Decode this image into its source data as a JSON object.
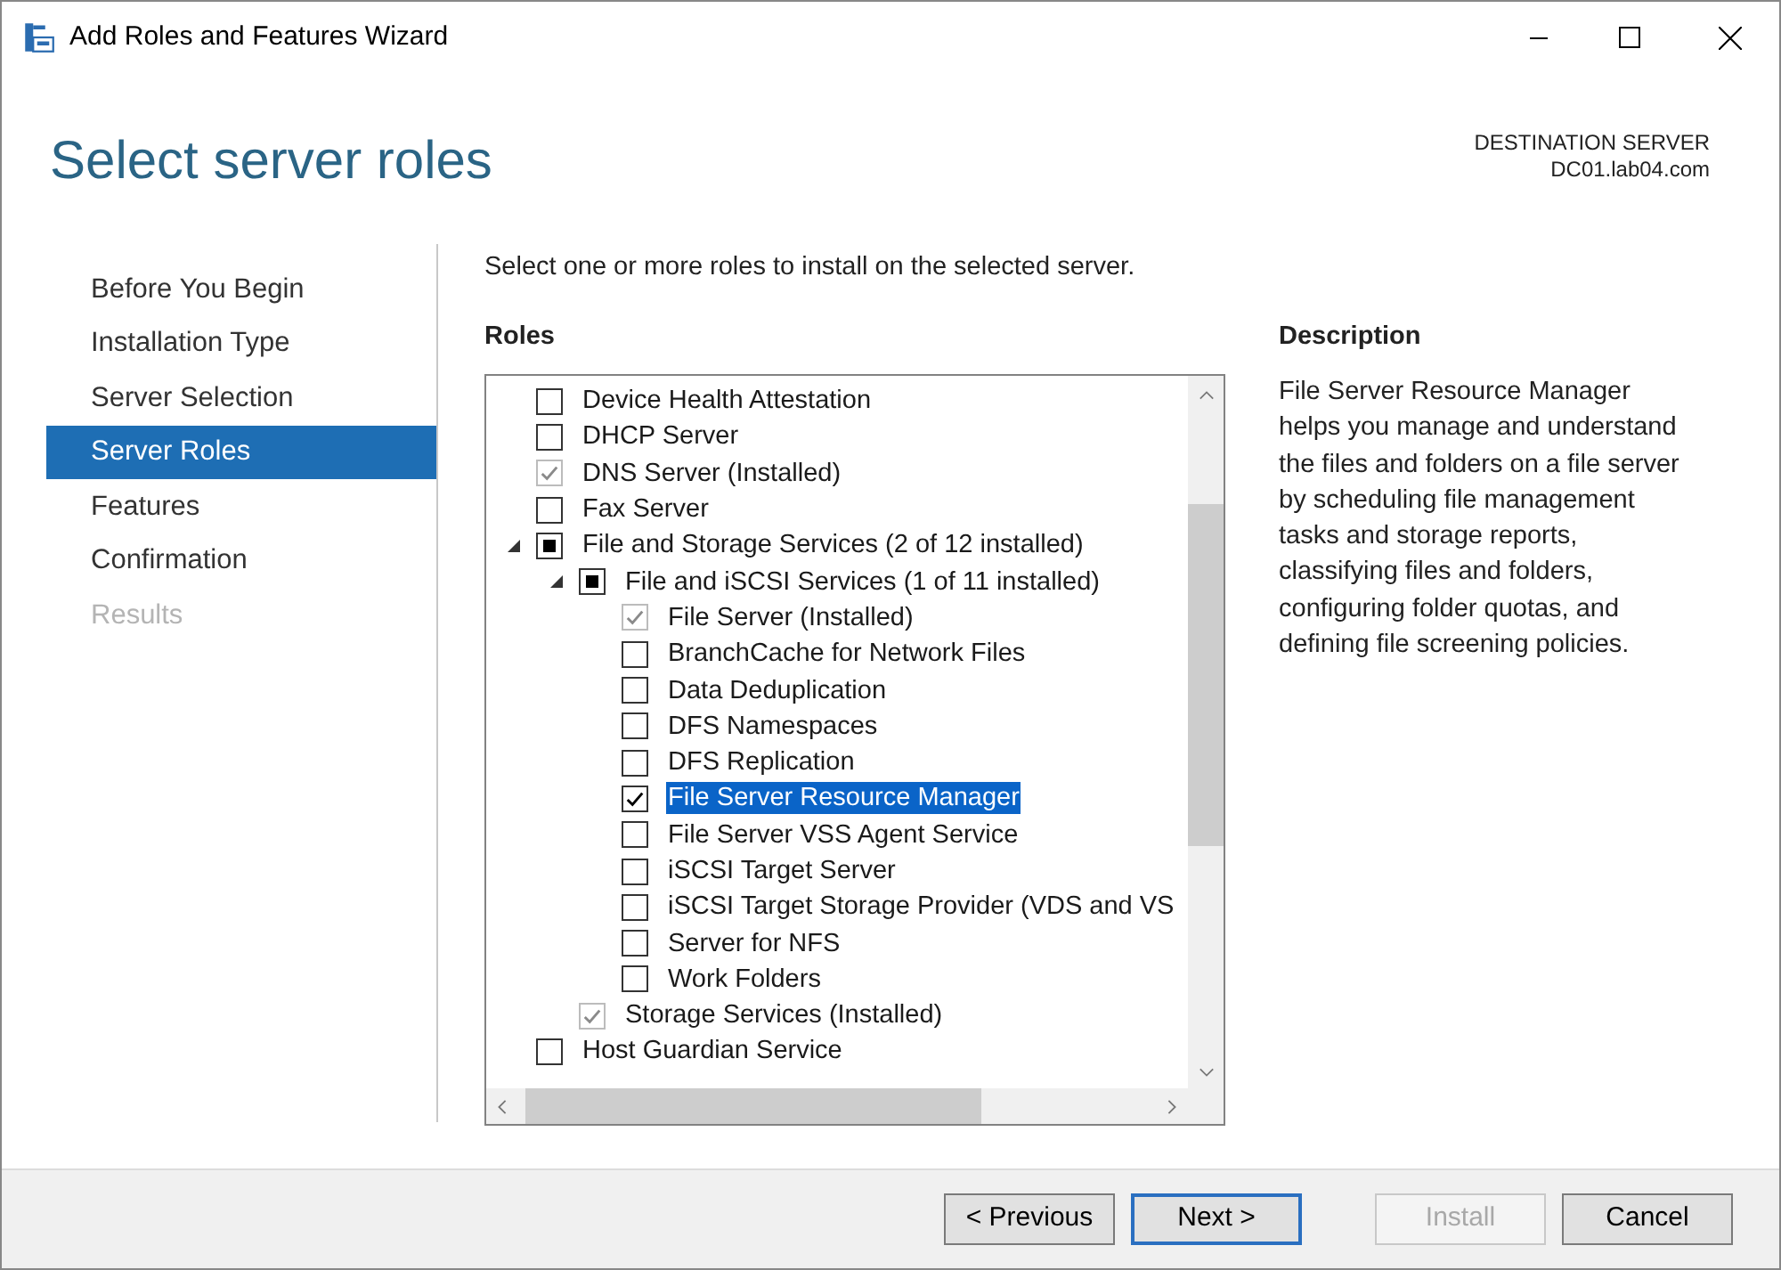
{
  "window": {
    "title": "Add Roles and Features Wizard"
  },
  "page_title": "Select server roles",
  "destination": {
    "label": "DESTINATION SERVER",
    "server": "DC01.lab04.com"
  },
  "steps": [
    {
      "label": "Before You Begin",
      "selected": false,
      "disabled": false
    },
    {
      "label": "Installation Type",
      "selected": false,
      "disabled": false
    },
    {
      "label": "Server Selection",
      "selected": false,
      "disabled": false
    },
    {
      "label": "Server Roles",
      "selected": true,
      "disabled": false
    },
    {
      "label": "Features",
      "selected": false,
      "disabled": false
    },
    {
      "label": "Confirmation",
      "selected": false,
      "disabled": false
    },
    {
      "label": "Results",
      "selected": false,
      "disabled": true
    }
  ],
  "instruction": "Select one or more roles to install on the selected server.",
  "roles_heading": "Roles",
  "roles": [
    {
      "label": "Device Health Attestation",
      "checked": false,
      "partial": false,
      "disabled": false,
      "selected": false
    },
    {
      "label": "DHCP Server",
      "checked": false,
      "partial": false,
      "disabled": false,
      "selected": false
    },
    {
      "label": "DNS Server (Installed)",
      "checked": true,
      "partial": false,
      "disabled": true,
      "selected": false
    },
    {
      "label": "Fax Server",
      "checked": false,
      "partial": false,
      "disabled": false,
      "selected": false
    },
    {
      "label": "File and Storage Services (2 of 12 installed)",
      "checked": false,
      "partial": true,
      "disabled": false,
      "selected": false,
      "expanded": true,
      "children": [
        {
          "label": "File and iSCSI Services (1 of 11 installed)",
          "checked": false,
          "partial": true,
          "disabled": false,
          "selected": false,
          "expanded": true,
          "children": [
            {
              "label": "File Server (Installed)",
              "checked": true,
              "partial": false,
              "disabled": true,
              "selected": false
            },
            {
              "label": "BranchCache for Network Files",
              "checked": false,
              "partial": false,
              "disabled": false,
              "selected": false
            },
            {
              "label": "Data Deduplication",
              "checked": false,
              "partial": false,
              "disabled": false,
              "selected": false
            },
            {
              "label": "DFS Namespaces",
              "checked": false,
              "partial": false,
              "disabled": false,
              "selected": false
            },
            {
              "label": "DFS Replication",
              "checked": false,
              "partial": false,
              "disabled": false,
              "selected": false
            },
            {
              "label": "File Server Resource Manager",
              "checked": true,
              "partial": false,
              "disabled": false,
              "selected": true
            },
            {
              "label": "File Server VSS Agent Service",
              "checked": false,
              "partial": false,
              "disabled": false,
              "selected": false
            },
            {
              "label": "iSCSI Target Server",
              "checked": false,
              "partial": false,
              "disabled": false,
              "selected": false
            },
            {
              "label": "iSCSI Target Storage Provider (VDS and VS",
              "checked": false,
              "partial": false,
              "disabled": false,
              "selected": false
            },
            {
              "label": "Server for NFS",
              "checked": false,
              "partial": false,
              "disabled": false,
              "selected": false
            },
            {
              "label": "Work Folders",
              "checked": false,
              "partial": false,
              "disabled": false,
              "selected": false
            }
          ]
        },
        {
          "label": "Storage Services (Installed)",
          "checked": true,
          "partial": false,
          "disabled": true,
          "selected": false
        }
      ]
    },
    {
      "label": "Host Guardian Service",
      "checked": false,
      "partial": false,
      "disabled": false,
      "selected": false
    }
  ],
  "description": {
    "heading": "Description",
    "text": "File Server Resource Manager helps you manage and understand the files and folders on a file server by scheduling file management tasks and storage reports, classifying files and folders, configuring folder quotas, and defining file screening policies."
  },
  "buttons": [
    {
      "label": "< Previous",
      "disabled": false,
      "default": false
    },
    {
      "label": "Next >",
      "disabled": false,
      "default": true
    },
    {
      "label": "Install",
      "disabled": true,
      "default": false
    },
    {
      "label": "Cancel",
      "disabled": false,
      "default": false
    }
  ]
}
